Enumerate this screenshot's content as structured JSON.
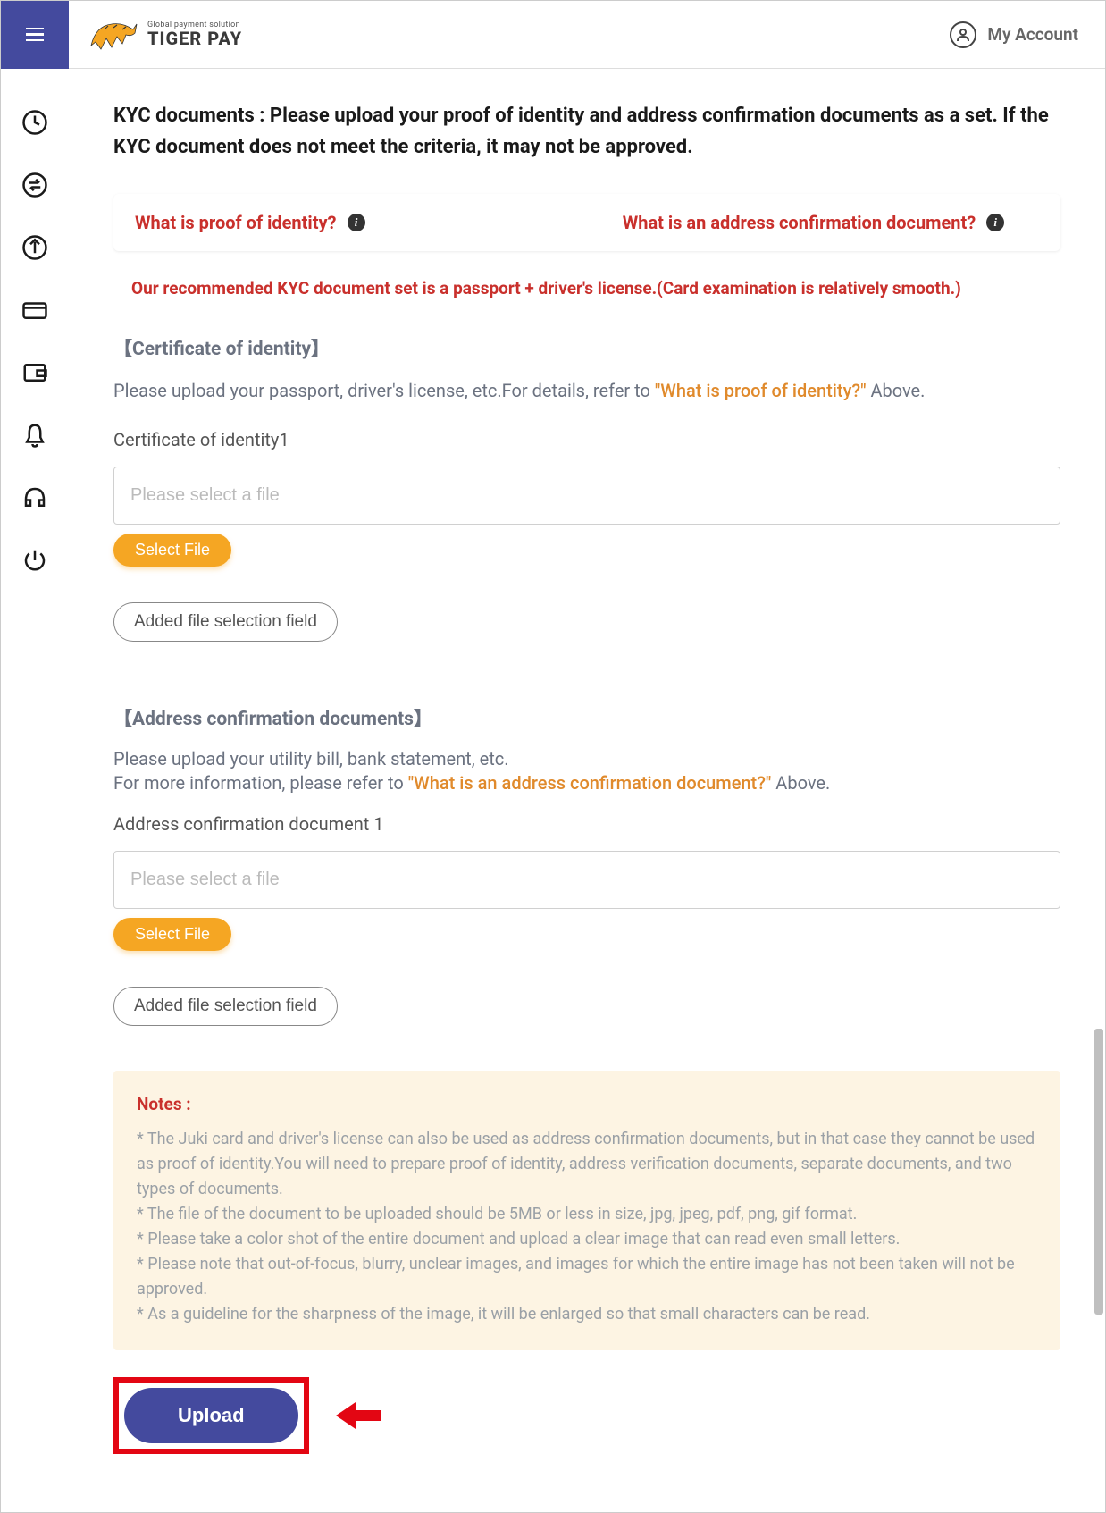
{
  "header": {
    "logo_tagline": "Global payment solution",
    "logo_brand": "TIGER PAY",
    "account_label": "My Account"
  },
  "kyc": {
    "heading": "KYC documents : Please upload your proof of identity and address confirmation documents as a set. If the KYC document does not meet the criteria, it may not be approved.",
    "info_identity": "What is proof of identity?",
    "info_address": "What is an address confirmation document?",
    "recommend": "Our recommended KYC document set is a passport + driver's license.(Card examination is relatively smooth.)"
  },
  "identity": {
    "section_title": "【Certificate of identity】",
    "desc_pre": "Please upload your passport, driver's license, etc.For details, refer to ",
    "desc_link": "\"What is proof of identity?\"",
    "desc_post": " Above.",
    "field_label": "Certificate of identity1",
    "placeholder": "Please select a file",
    "select_btn": "Select File",
    "add_field_btn": "Added file selection field"
  },
  "address": {
    "section_title": "【Address confirmation documents】",
    "desc_line1": "Please upload your utility bill, bank statement, etc.",
    "desc_line2_pre": "For more information, please refer to ",
    "desc_link": "\"What is an address confirmation document?\"",
    "desc_line2_post": " Above.",
    "field_label": "Address confirmation document 1",
    "placeholder": "Please select a file",
    "select_btn": "Select File",
    "add_field_btn": "Added file selection field"
  },
  "notes": {
    "title": "Notes :",
    "items": [
      "* The Juki card and driver's license can also be used as address confirmation documents, but in that case they cannot be used as proof of identity.You will need to prepare proof of identity, address verification documents, separate documents, and two types of documents.",
      "* The file of the document to be uploaded should be 5MB or less in size, jpg, jpeg, pdf, png, gif format.",
      "* Please take a color shot of the entire document and upload a clear image that can read even small letters.",
      "* Please note that out-of-focus, blurry, unclear images, and images for which the entire image has not been taken will not be approved.",
      "* As a guideline for the sharpness of the image, it will be enlarged so that small characters can be read."
    ]
  },
  "upload_btn": "Upload"
}
